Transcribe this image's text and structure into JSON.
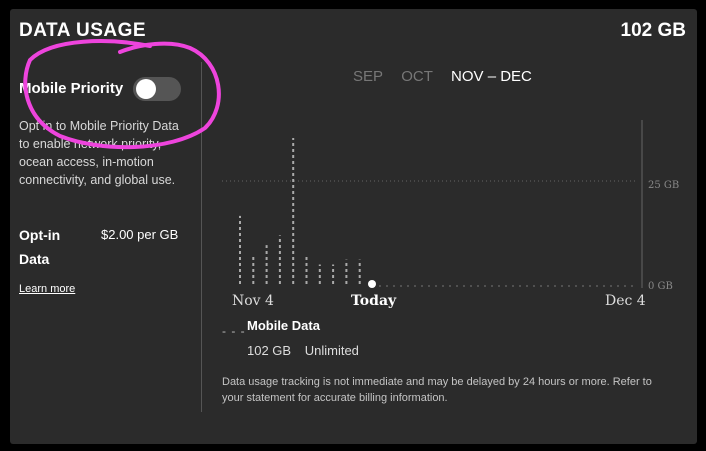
{
  "header": {
    "title": "DATA USAGE",
    "total": "102 GB"
  },
  "mobile_priority": {
    "label": "Mobile Priority",
    "toggle_on": false,
    "description": "Opt in to Mobile Priority Data to enable network priority, ocean access, in-motion connectivity, and global use.",
    "optin_label": "Opt-in Data",
    "optin_price": "$2.00 per GB",
    "learn_more": "Learn more"
  },
  "months": {
    "items": [
      {
        "label": "SEP",
        "active": false
      },
      {
        "label": "OCT",
        "active": false
      },
      {
        "label": "NOV – DEC",
        "active": true
      }
    ]
  },
  "chart_data": {
    "type": "bar",
    "x_labels": [
      "Nov 4",
      "Today",
      "Dec 4"
    ],
    "y_ticks": [
      "25 GB",
      "0 GB"
    ],
    "ylim": [
      0,
      30
    ],
    "grid": "dotted horizontal at 25 GB",
    "series": [
      {
        "name": "Mobile Data",
        "style": "dashed",
        "values": [
          14,
          6,
          8,
          10,
          30,
          6,
          4,
          4,
          5,
          5
        ]
      }
    ]
  },
  "legend": {
    "series_name": "Mobile Data",
    "amount": "102 GB",
    "plan": "Unlimited",
    "marker": "- - -"
  },
  "footnote": "Data usage tracking is not immediate and may be delayed by 24 hours or more. Refer to your statement for accurate billing information.",
  "colors": {
    "panel": "#2b2b2b",
    "annotation": "#ee44dd"
  }
}
